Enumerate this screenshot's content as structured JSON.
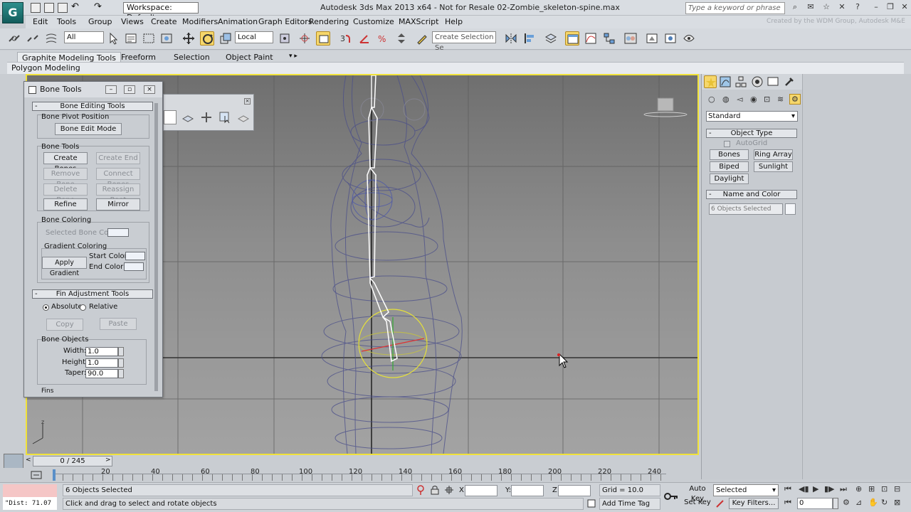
{
  "app": {
    "logo_letter": "G",
    "title": "Autodesk 3ds Max  2013 x64    - Not for Resale    02-Zombie_skeleton-spine.max",
    "workspace": "Workspace: Default",
    "search_placeholder": "Type a keyword or phrase",
    "credit": "Created by the WDM Group, Autodesk M&E"
  },
  "menu": [
    "Edit",
    "Tools",
    "Group",
    "Views",
    "Create",
    "Modifiers",
    "Animation",
    "Graph Editors",
    "Rendering",
    "Customize",
    "MAXScript",
    "Help"
  ],
  "toolbar": {
    "filter": "All",
    "ref_coord": "Local",
    "selection_set_placeholder": "Create Selection Se"
  },
  "ribbon": {
    "tabs": [
      "Graphite Modeling Tools",
      "Freeform",
      "Selection",
      "Object Paint"
    ],
    "subtitle": "Polygon Modeling"
  },
  "bone_tools": {
    "title": "Bone Tools",
    "editing_rollout": "Bone Editing Tools",
    "pivot_group": "Bone Pivot Position",
    "bone_edit_mode": "Bone Edit Mode",
    "tools_group": "Bone Tools",
    "create_bones": "Create Bones",
    "create_end": "Create End",
    "remove_bone": "Remove Bone",
    "connect_bones": "Connect Bones",
    "delete_bone": "Delete Bone",
    "reassign_root": "Reassign Root",
    "refine": "Refine",
    "mirror": "Mirror",
    "coloring_group": "Bone Coloring",
    "selected_bone_color": "Selected Bone Color:",
    "gradient_group": "Gradient Coloring",
    "apply_gradient": "Apply Gradient",
    "start_color": "Start Color:",
    "end_color": "End Color:",
    "fin_rollout": "Fin Adjustment Tools",
    "absolute": "Absolute",
    "relative": "Relative",
    "copy": "Copy",
    "paste": "Paste",
    "bone_objects_group": "Bone Objects",
    "width_label": "Width:",
    "width_value": "1.0",
    "height_label": "Height:",
    "height_value": "1.0",
    "taper_label": "Taper:",
    "taper_value": "90.0",
    "fins_label": "Fins"
  },
  "command_panel": {
    "category": "Standard",
    "object_type_rollout": "Object Type",
    "autogrid": "AutoGrid",
    "buttons": [
      "Bones",
      "Ring Array",
      "Biped",
      "Sunlight",
      "Daylight"
    ],
    "name_color_rollout": "Name and Color",
    "name_value": "6 Objects Selected"
  },
  "timeline": {
    "frame": "0 / 245",
    "ticks": [
      "20",
      "40",
      "60",
      "80",
      "100",
      "120",
      "140",
      "160",
      "180",
      "200",
      "220",
      "240"
    ]
  },
  "status": {
    "maxscript_output": "\"Dist: 71.07",
    "selection": "6 Objects Selected",
    "prompt": "Click and drag to select and rotate objects",
    "x_label": "X:",
    "y_label": "Y:",
    "z_label": "Z:",
    "grid": "Grid = 10.0",
    "add_time_tag": "Add Time Tag",
    "auto_key": "Auto Key",
    "set_key": "Set Key",
    "key_mode": "Selected",
    "key_filters": "Key Filters...",
    "current_frame": "0"
  },
  "colors": {
    "viewport_border": "#f0e23a",
    "skeleton": "#ffffff",
    "wireframe": "#4a4e8a",
    "gizmo": "#e5e03a"
  }
}
